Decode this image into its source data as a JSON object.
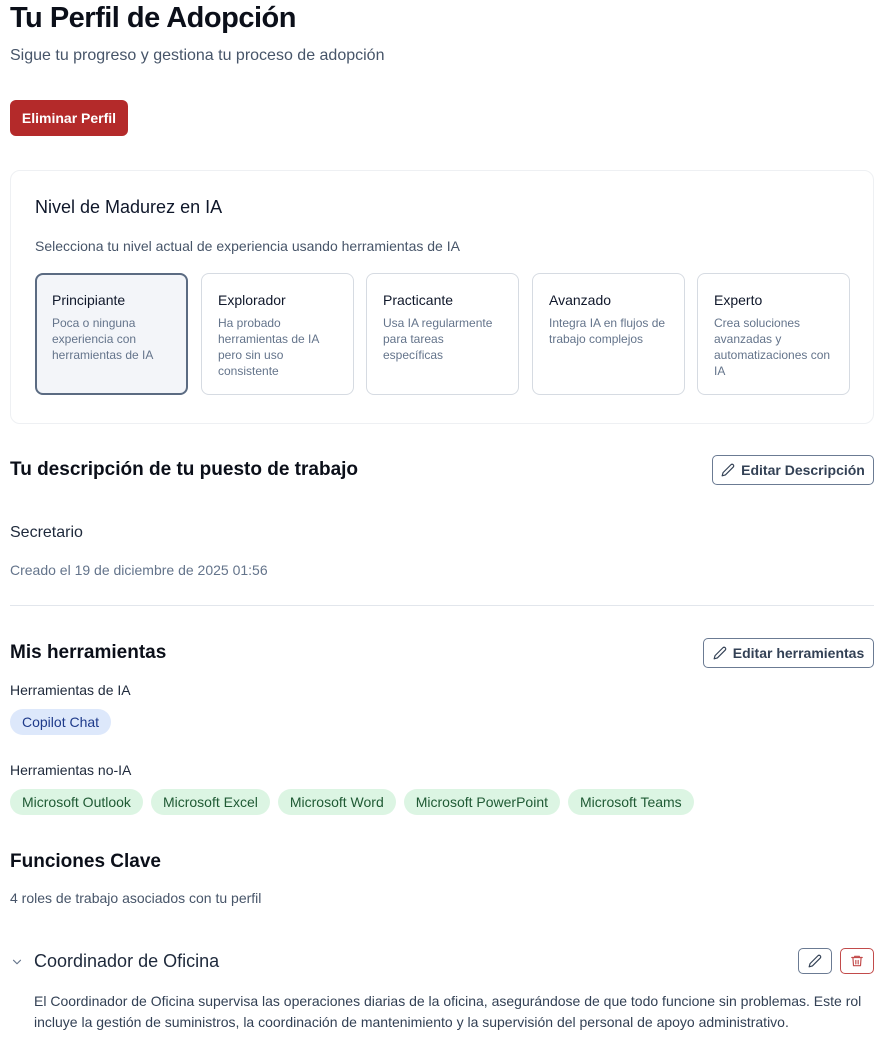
{
  "header": {
    "title": "Tu Perfil de Adopción",
    "subtitle": "Sigue tu progreso y gestiona tu proceso de adopción",
    "delete_label": "Eliminar Perfil"
  },
  "maturity": {
    "title": "Nivel de Madurez en IA",
    "subtitle": "Selecciona tu nivel actual de experiencia usando herramientas de IA",
    "selected": "Principiante",
    "levels": [
      {
        "name": "Principiante",
        "desc": "Poca o ninguna experiencia con herramientas de IA"
      },
      {
        "name": "Explorador",
        "desc": "Ha probado herramientas de IA pero sin uso consistente"
      },
      {
        "name": "Practicante",
        "desc": "Usa IA regularmente para tareas específicas"
      },
      {
        "name": "Avanzado",
        "desc": "Integra IA en flujos de trabajo complejos"
      },
      {
        "name": "Experto",
        "desc": "Crea soluciones avanzadas y automatizaciones con IA"
      }
    ]
  },
  "job": {
    "title": "Tu descripción de tu puesto de trabajo",
    "edit_label": "Editar Descripción",
    "value": "Secretario",
    "created": "Creado el 19 de diciembre de 2025 01:56"
  },
  "tools": {
    "title": "Mis herramientas",
    "edit_label": "Editar herramientas",
    "ai_label": "Herramientas de IA",
    "ai_tools": [
      "Copilot Chat"
    ],
    "non_ai_label": "Herramientas no-IA",
    "non_ai_tools": [
      "Microsoft Outlook",
      "Microsoft Excel",
      "Microsoft Word",
      "Microsoft PowerPoint",
      "Microsoft Teams"
    ]
  },
  "functions": {
    "title": "Funciones Clave",
    "subtitle": "4 roles de trabajo asociados con tu perfil",
    "roles": [
      {
        "name": "Coordinador de Oficina",
        "desc": "El Coordinador de Oficina supervisa las operaciones diarias de la oficina, asegurándose de que todo funcione sin problemas. Este rol incluye la gestión de suministros, la coordinación de mantenimiento y la supervisión del personal de apoyo administrativo."
      }
    ]
  },
  "colors": {
    "danger": "#b42a2a",
    "ai_chip_bg": "#dde8fb",
    "non_ai_chip_bg": "#dcf5e3",
    "selected_border": "#5b6b82"
  },
  "icons": {
    "edit": "pencil-icon",
    "delete": "trash-icon",
    "expand": "chevron-down-icon"
  }
}
